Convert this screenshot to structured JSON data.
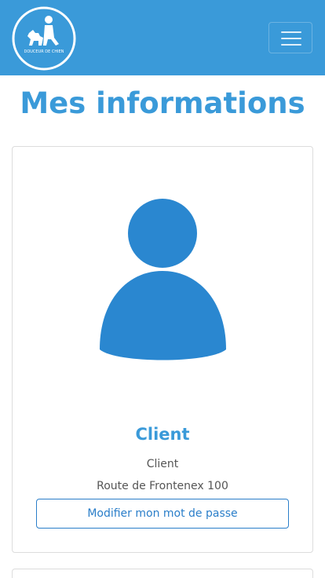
{
  "header": {
    "logo_text": "DOUCEUR DE CHIEN",
    "logo_icon": "dog-trainer-logo",
    "menu_icon": "hamburger-menu-icon",
    "background_color": "#3a9ad9"
  },
  "main": {
    "title": "Mes informations"
  },
  "profile": {
    "avatar_icon": "user-avatar-icon",
    "name": "Client",
    "role": "Client",
    "address": "Route de Frontenex 100",
    "change_password_label": "Modifier mon mot de passe"
  },
  "colors": {
    "accent": "#3a9ad9",
    "avatar": "#2a87d0",
    "button_border": "#2a7ec9"
  }
}
